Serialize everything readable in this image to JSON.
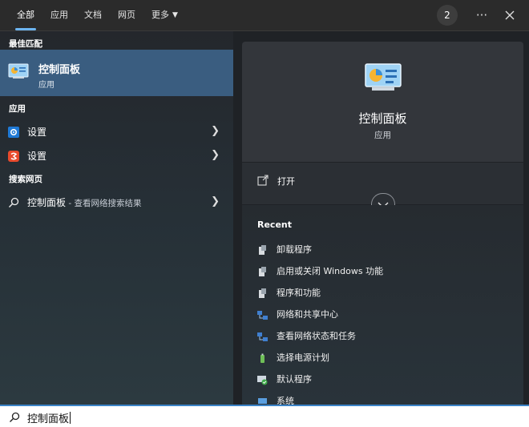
{
  "tabs": [
    {
      "label": "全部",
      "active": true
    },
    {
      "label": "应用"
    },
    {
      "label": "文档"
    },
    {
      "label": "网页"
    },
    {
      "label": "更多"
    }
  ],
  "badge": "2",
  "sections": {
    "best_match": "最佳匹配",
    "apps": "应用",
    "web": "搜索网页"
  },
  "best_match": {
    "title": "控制面板",
    "subtitle": "应用"
  },
  "apps": [
    {
      "label": "设置",
      "icon": "gear-icon"
    },
    {
      "label": "设置",
      "icon": "settings-app-icon"
    }
  ],
  "web_result": {
    "label": "控制面板",
    "hint": " - 查看网络搜索结果"
  },
  "preview": {
    "title": "控制面板",
    "kind": "应用",
    "open_label": "打开",
    "recent_head": "Recent",
    "recent": [
      {
        "label": "卸载程序"
      },
      {
        "label": "启用或关闭 Windows 功能"
      },
      {
        "label": "程序和功能"
      },
      {
        "label": "网络和共享中心"
      },
      {
        "label": "查看网络状态和任务"
      },
      {
        "label": "选择电源计划"
      },
      {
        "label": "默认程序"
      },
      {
        "label": "系统"
      }
    ]
  },
  "search": {
    "value": "控制面板"
  },
  "colors": {
    "accent": "#3b83c7",
    "selected": "#3a5d80"
  }
}
